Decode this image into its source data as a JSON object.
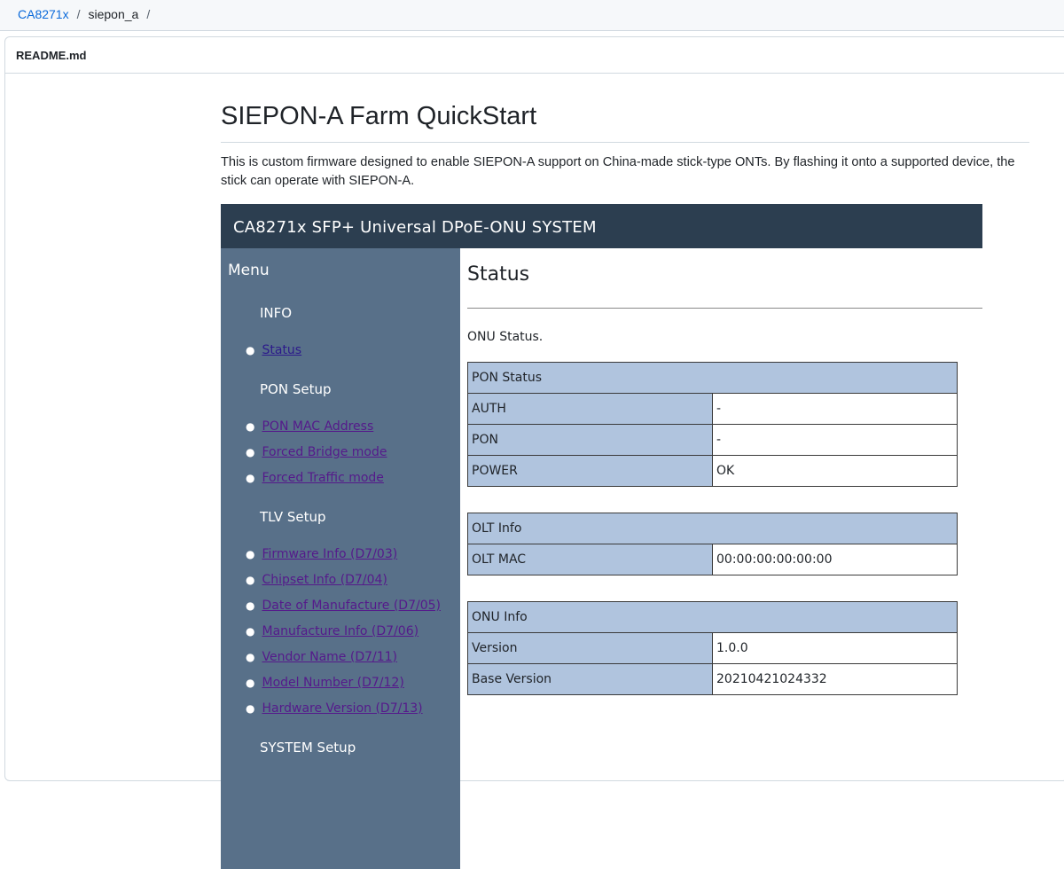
{
  "breadcrumb": {
    "repo": "CA8271x",
    "folder": "siepon_a",
    "separator": "/"
  },
  "readme": {
    "filename": "README.md",
    "title": "SIEPON-A Farm QuickStart",
    "intro": "This is custom firmware designed to enable SIEPON-A support on China-made stick-type ONTs. By flashing it onto a supported device, the stick can operate with SIEPON-A."
  },
  "device_ui": {
    "banner": "CA8271x SFP+ Universal DPoE-ONU SYSTEM",
    "menu_title": "Menu",
    "sections": {
      "info": "INFO",
      "pon": "PON Setup",
      "tlv": "TLV Setup",
      "system": "SYSTEM Setup"
    },
    "info_items": [
      "Status"
    ],
    "pon_items": [
      "PON MAC Address",
      "Forced Bridge mode",
      "Forced Traffic mode"
    ],
    "tlv_items": [
      "Firmware Info (D7/03)",
      "Chipset Info (D7/04)",
      "Date of Manufacture (D7/05)",
      "Manufacture Info (D7/06)",
      "Vendor Name (D7/11)",
      "Model Number (D7/12)",
      "Hardware Version (D7/13)"
    ],
    "page_title": "Status",
    "lead": "ONU Status.",
    "pon_status": {
      "header": "PON Status",
      "rows": [
        {
          "label": "AUTH",
          "value": "-"
        },
        {
          "label": "PON",
          "value": "-"
        },
        {
          "label": "POWER",
          "value": "OK"
        }
      ]
    },
    "olt_info": {
      "header": "OLT Info",
      "rows": [
        {
          "label": "OLT MAC",
          "value": "00:00:00:00:00:00"
        }
      ]
    },
    "onu_info": {
      "header": "ONU Info",
      "rows": [
        {
          "label": "Version",
          "value": "1.0.0"
        },
        {
          "label": "Base Version",
          "value": "20210421024332"
        }
      ]
    }
  },
  "colors": {
    "link": "#0969da",
    "banner": "#2c3e50",
    "sidebar": "#587089",
    "table_header": "#b0c4de",
    "visited_link": "#551a8b"
  }
}
